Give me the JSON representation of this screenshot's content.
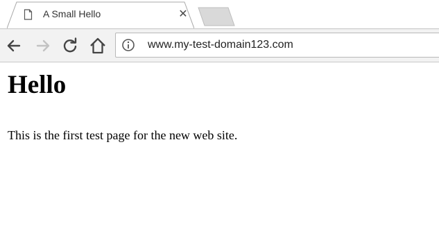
{
  "tab": {
    "title": "A Small Hello",
    "close_glyph": "✕",
    "icon": "page-icon"
  },
  "toolbar": {
    "back_icon": "arrow-left-icon",
    "forward_icon": "arrow-right-icon",
    "reload_icon": "reload-icon",
    "home_icon": "home-icon",
    "security_icon": "info-icon"
  },
  "omnibox": {
    "url": "www.my-test-domain123.com"
  },
  "page": {
    "heading": "Hello",
    "paragraph": "This is the first test page for the new web site."
  }
}
